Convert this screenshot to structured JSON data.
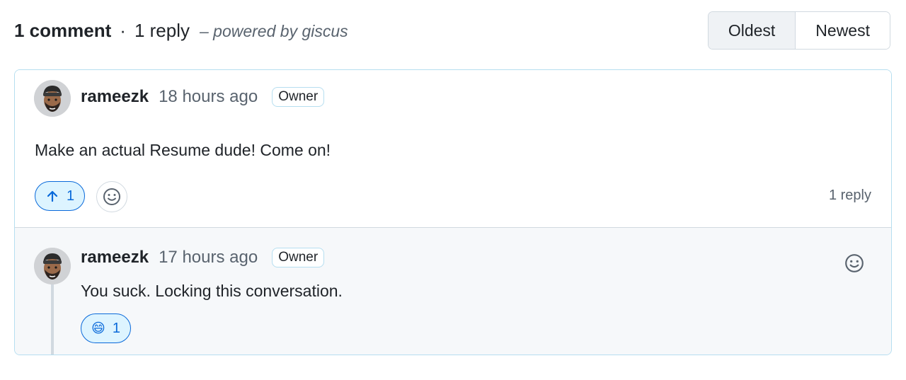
{
  "header": {
    "comment_count": "1 comment",
    "separator": "·",
    "reply_count": "1 reply",
    "powered_by": "– powered by giscus",
    "sort_options": [
      "Oldest",
      "Newest"
    ],
    "active_sort": "Oldest"
  },
  "comment": {
    "author": "rameezk",
    "time": "18 hours ago",
    "badge": "Owner",
    "body": "Make an actual Resume dude! Come on!",
    "reactions": [
      {
        "icon": "arrow-up-icon",
        "count": "1"
      }
    ],
    "replies_label": "1 reply"
  },
  "reply": {
    "author": "rameezk",
    "time": "17 hours ago",
    "badge": "Owner",
    "body": "You suck. Locking this conversation.",
    "reactions": [
      {
        "icon": "grinning-face-emoji",
        "emoji": "😄",
        "count": "1"
      }
    ]
  },
  "colors": {
    "accent": "#0969da",
    "accent_bg": "#ddf4ff",
    "border_blue": "#b6def0",
    "reply_bg": "#f6f8fa",
    "muted_text": "#59636e"
  }
}
